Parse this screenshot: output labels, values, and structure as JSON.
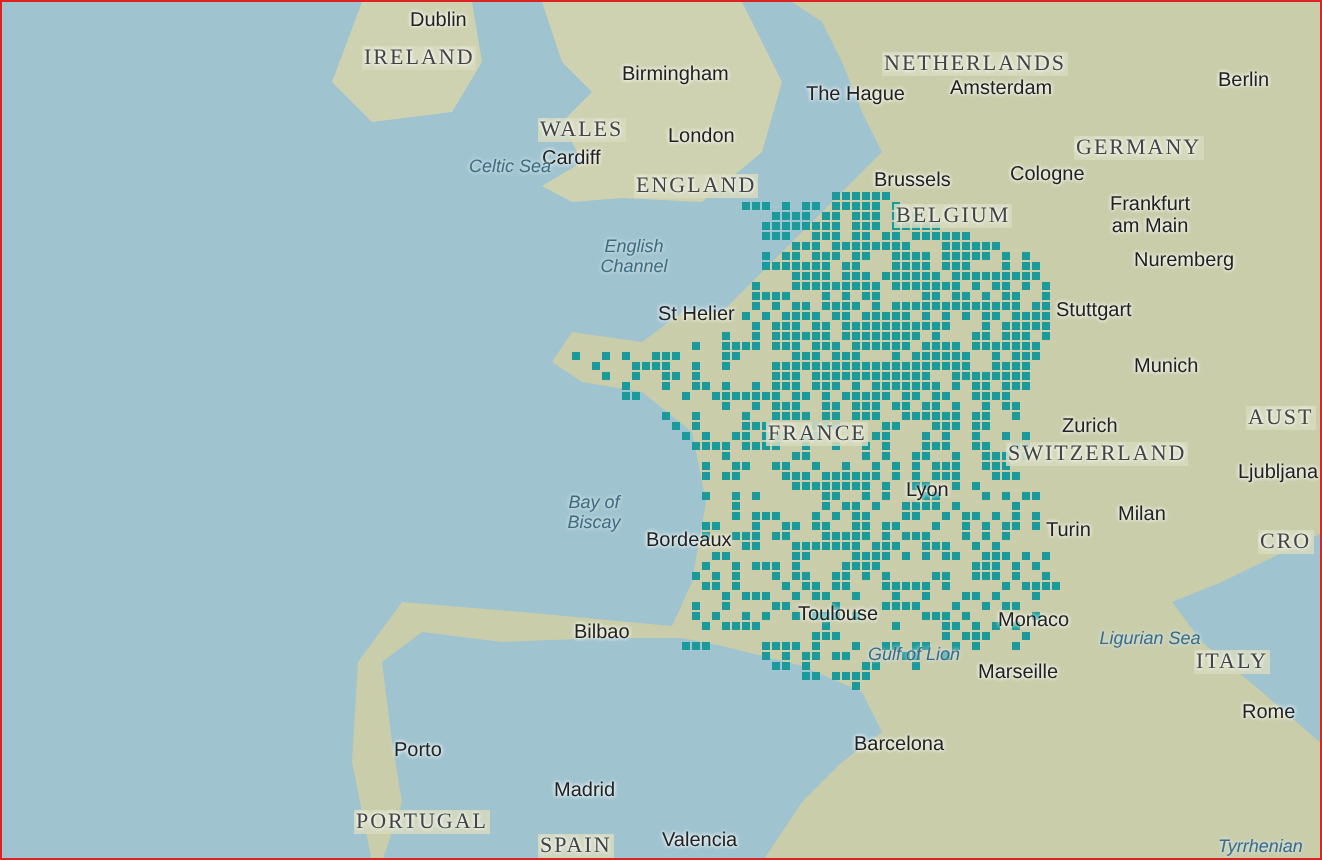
{
  "map": {
    "labels": [
      {
        "text": "Dublin",
        "kind": "city"
      },
      {
        "text": "IRELAND",
        "kind": "country"
      },
      {
        "text": "Birmingham",
        "kind": "city"
      },
      {
        "text": "WALES",
        "kind": "country"
      },
      {
        "text": "Cardiff",
        "kind": "city"
      },
      {
        "text": "London",
        "kind": "city"
      },
      {
        "text": "Celtic Sea",
        "kind": "water"
      },
      {
        "text": "ENGLAND",
        "kind": "country"
      },
      {
        "text": "English Channel",
        "kind": "water"
      },
      {
        "text": "St Helier",
        "kind": "city"
      },
      {
        "text": "NETHERLANDS",
        "kind": "country"
      },
      {
        "text": "The Hague",
        "kind": "city"
      },
      {
        "text": "Amsterdam",
        "kind": "city"
      },
      {
        "text": "Berlin",
        "kind": "city"
      },
      {
        "text": "GERMANY",
        "kind": "country"
      },
      {
        "text": "Brussels",
        "kind": "city"
      },
      {
        "text": "Cologne",
        "kind": "city"
      },
      {
        "text": "BELGIUM",
        "kind": "country"
      },
      {
        "text": "Frankfurt am Main",
        "kind": "city"
      },
      {
        "text": "Nuremberg",
        "kind": "city"
      },
      {
        "text": "Stuttgart",
        "kind": "city"
      },
      {
        "text": "Munich",
        "kind": "city"
      },
      {
        "text": "FRANCE",
        "kind": "country"
      },
      {
        "text": "Zurich",
        "kind": "city"
      },
      {
        "text": "SWITZERLAND",
        "kind": "country"
      },
      {
        "text": "AUST",
        "kind": "country"
      },
      {
        "text": "Ljubljana",
        "kind": "city"
      },
      {
        "text": "Bay of Biscay",
        "kind": "water"
      },
      {
        "text": "Lyon",
        "kind": "city"
      },
      {
        "text": "Milan",
        "kind": "city"
      },
      {
        "text": "Turin",
        "kind": "city"
      },
      {
        "text": "CRO",
        "kind": "country"
      },
      {
        "text": "Bordeaux",
        "kind": "city"
      },
      {
        "text": "Bilbao",
        "kind": "city"
      },
      {
        "text": "Toulouse",
        "kind": "city"
      },
      {
        "text": "Monaco",
        "kind": "city"
      },
      {
        "text": "Ligurian Sea",
        "kind": "water"
      },
      {
        "text": "Marseille",
        "kind": "city"
      },
      {
        "text": "Gulf of Lion",
        "kind": "water"
      },
      {
        "text": "ITALY",
        "kind": "country"
      },
      {
        "text": "Rome",
        "kind": "city"
      },
      {
        "text": "Porto",
        "kind": "city"
      },
      {
        "text": "Barcelona",
        "kind": "city"
      },
      {
        "text": "Madrid",
        "kind": "city"
      },
      {
        "text": "PORTUGAL",
        "kind": "country"
      },
      {
        "text": "SPAIN",
        "kind": "country"
      },
      {
        "text": "Valencia",
        "kind": "city"
      },
      {
        "text": "Tyrrhenian",
        "kind": "water"
      }
    ]
  }
}
